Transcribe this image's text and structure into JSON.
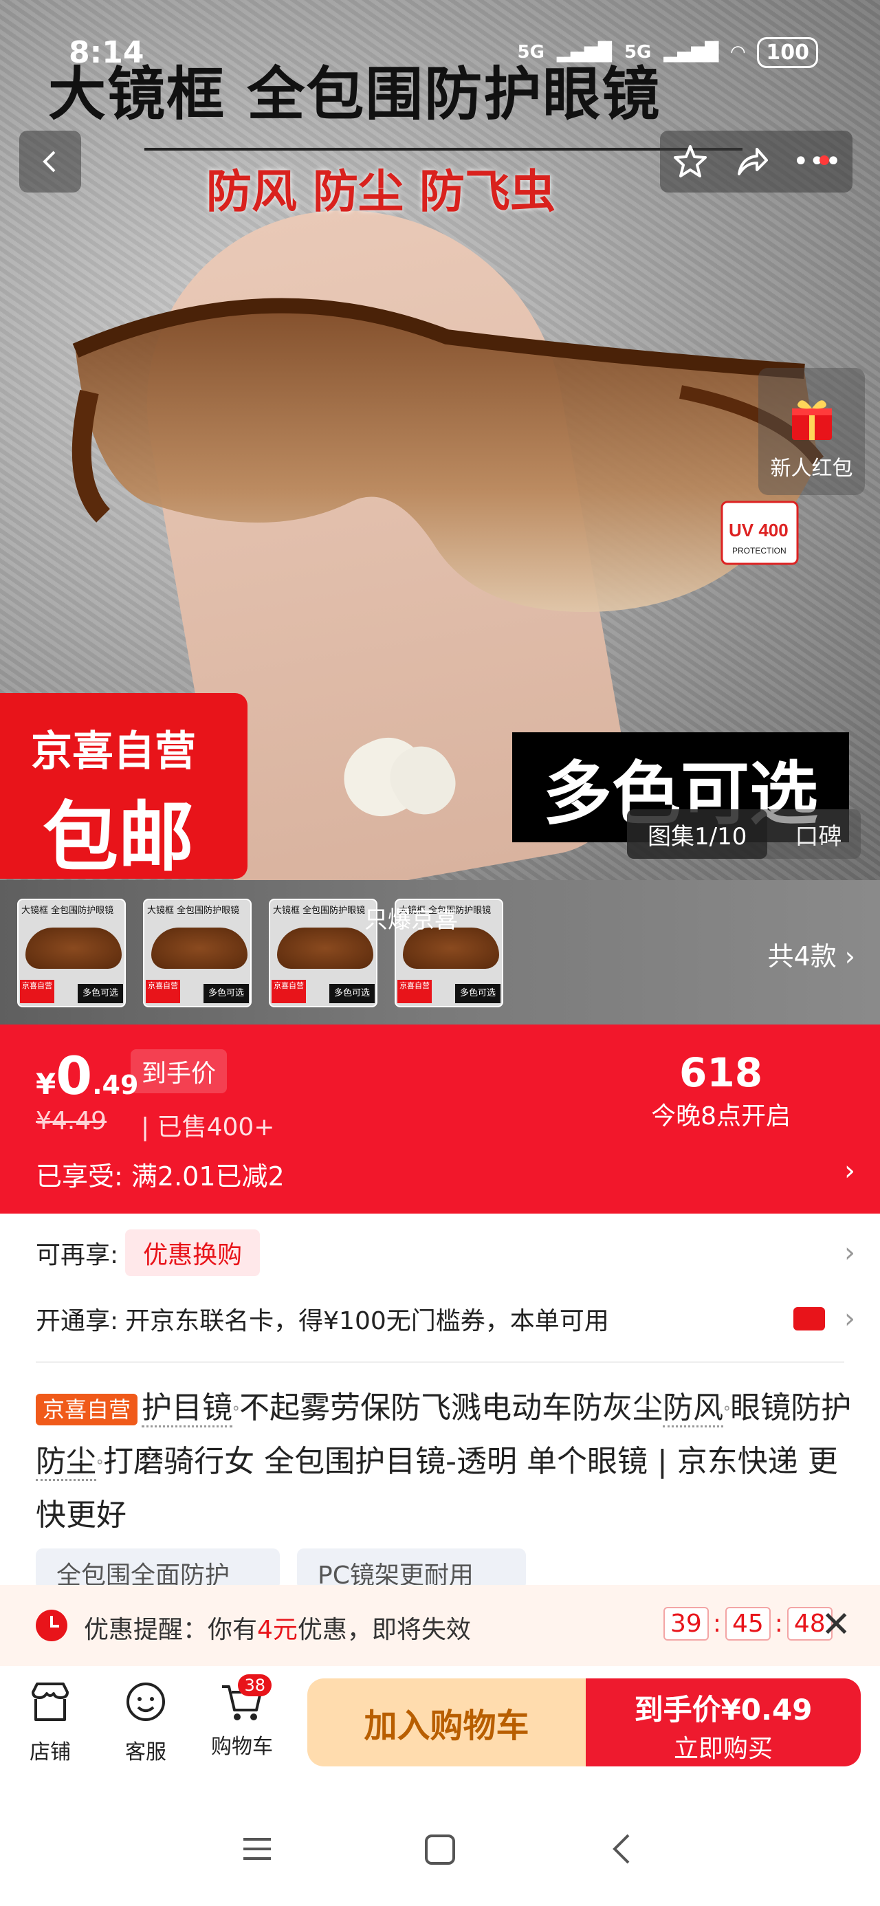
{
  "status": {
    "time": "8:14",
    "battery": "100",
    "net1": "5G",
    "net2": "5G"
  },
  "hero": {
    "title": "大镜框 全包围防护眼镜",
    "subtitle": "防风 防尘 防飞虫",
    "badge_line1": "京喜自营",
    "badge_line2": "包邮",
    "colors_label": "多色可选",
    "gallery_tab": "图集1/10",
    "review_tab": "口碑",
    "red_packet_label": "新人红包",
    "uv_label": "UV 400"
  },
  "sku": {
    "more_label": "共4款",
    "live_label": "只爆京喜",
    "thumb_title": "大镜框 全包围防护眼镜",
    "thumb_badge": "京喜自营",
    "thumb_colors": "多色可选"
  },
  "price": {
    "currency": "¥",
    "integer": "0",
    "decimal": ".49",
    "label": "到手价",
    "original": "¥4.49",
    "sold": "已售400+",
    "promo_big": "618",
    "promo_small": "今晚8点开启",
    "enjoy_label": "已享受:",
    "enjoy_value": "满2.01已减2"
  },
  "offers": {
    "more_label": "可再享:",
    "more_chip": "优惠换购",
    "open_label": "开通享:",
    "open_value": "开京东联名卡，得¥100无门槛券，本单可用"
  },
  "product": {
    "tag": "京喜自营",
    "title_parts": [
      "护目镜",
      "不起雾劳保防飞溅电动车防灰尘",
      "防风",
      "眼镜防护",
      "防尘",
      "打磨骑行女 全包围护目镜-透明 单个眼镜 | 京东快递 更快更好"
    ]
  },
  "features": [
    "全包围全面防护",
    "PC镜架更耐用"
  ],
  "reminder": {
    "prefix": "优惠提醒：你有",
    "amount": "4元",
    "suffix": "优惠，即将失效",
    "h": "39",
    "m": "45",
    "s": "48"
  },
  "bottom": {
    "store": "店铺",
    "service": "客服",
    "cart": "购物车",
    "cart_count": "38",
    "add_cart": "加入购物车",
    "buy_price": "到手价¥0.49",
    "buy_now": "立即购买"
  },
  "colors": {
    "jd_red": "#f2172b",
    "badge_red": "#e8141a",
    "orange": "#f05a1a",
    "cart_btn": "#ffdcae"
  }
}
